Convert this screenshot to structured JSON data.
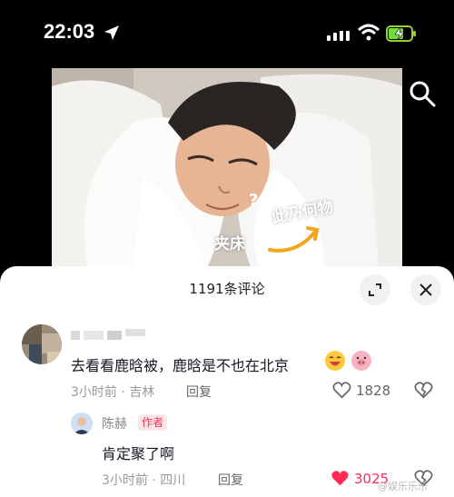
{
  "status": {
    "time": "22:03"
  },
  "panel": {
    "title": "1191条评论"
  },
  "comment1": {
    "text": "去看看鹿晗被，鹿晗是不也在北京",
    "time": "3小时前 · 吉林",
    "reply": "回复",
    "likes": "1828"
  },
  "comment2": {
    "author": "陈赫",
    "badge": "作者",
    "text": "肯定聚了啊",
    "time": "3小时前 · 四川",
    "reply": "回复",
    "likes": "3025"
  },
  "video": {
    "caption1": "此乃何物",
    "caption2": "夹床",
    "question": "?"
  },
  "watermark": "@娱乐乐乐",
  "colors": {
    "accent": "#fe2c55",
    "muted": "#999999",
    "text": "#161823"
  }
}
